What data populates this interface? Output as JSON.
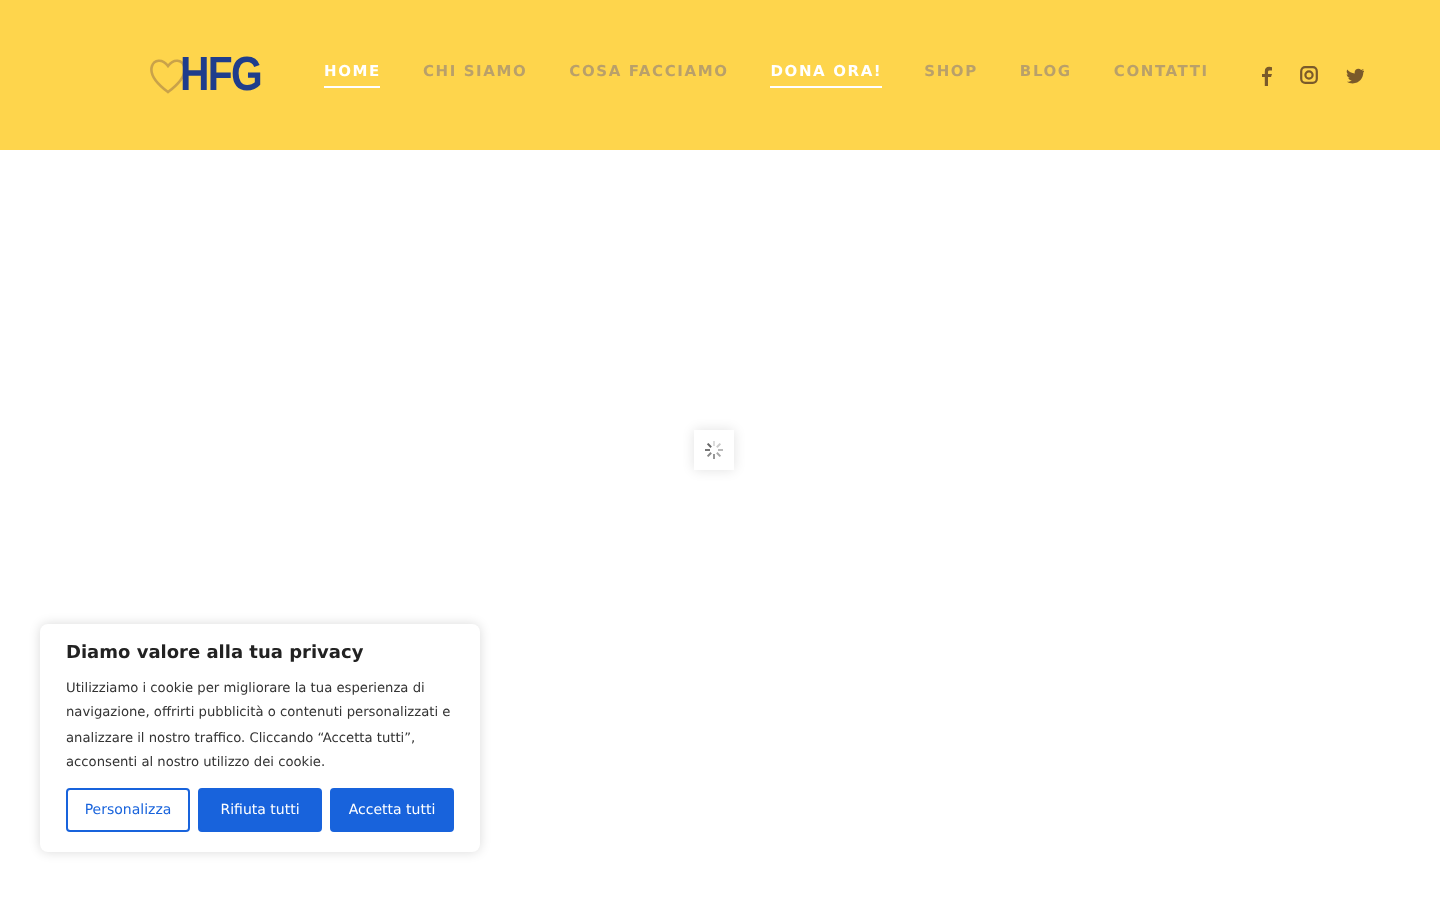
{
  "header": {
    "logo": "HFG",
    "nav": [
      {
        "label": "HOME",
        "selected": true
      },
      {
        "label": "CHI SIAMO",
        "selected": false
      },
      {
        "label": "COSA FACCIAMO",
        "selected": false
      },
      {
        "label": "DONA ORA!",
        "selected": true
      },
      {
        "label": "SHOP",
        "selected": false
      },
      {
        "label": "BLOG",
        "selected": false
      },
      {
        "label": "CONTATTI",
        "selected": false
      }
    ],
    "social": [
      {
        "kind": "facebook"
      },
      {
        "kind": "instagram"
      },
      {
        "kind": "twitter"
      }
    ]
  },
  "cookie_banner": {
    "title": "Diamo valore alla tua privacy",
    "text": "Utilizziamo i cookie per migliorare la tua esperienza di navigazione, offrirti pubblicità o contenuti personalizzati e analizzare il nostro traffico. Cliccando “Accetta tutti”, acconsenti al nostro utilizzo dei cookie.",
    "buttons": [
      {
        "label": "Personalizza",
        "kind": "outline"
      },
      {
        "label": "Rifiuta tutti",
        "kind": "filled"
      },
      {
        "label": "Accetta tutti",
        "kind": "filled"
      }
    ]
  }
}
